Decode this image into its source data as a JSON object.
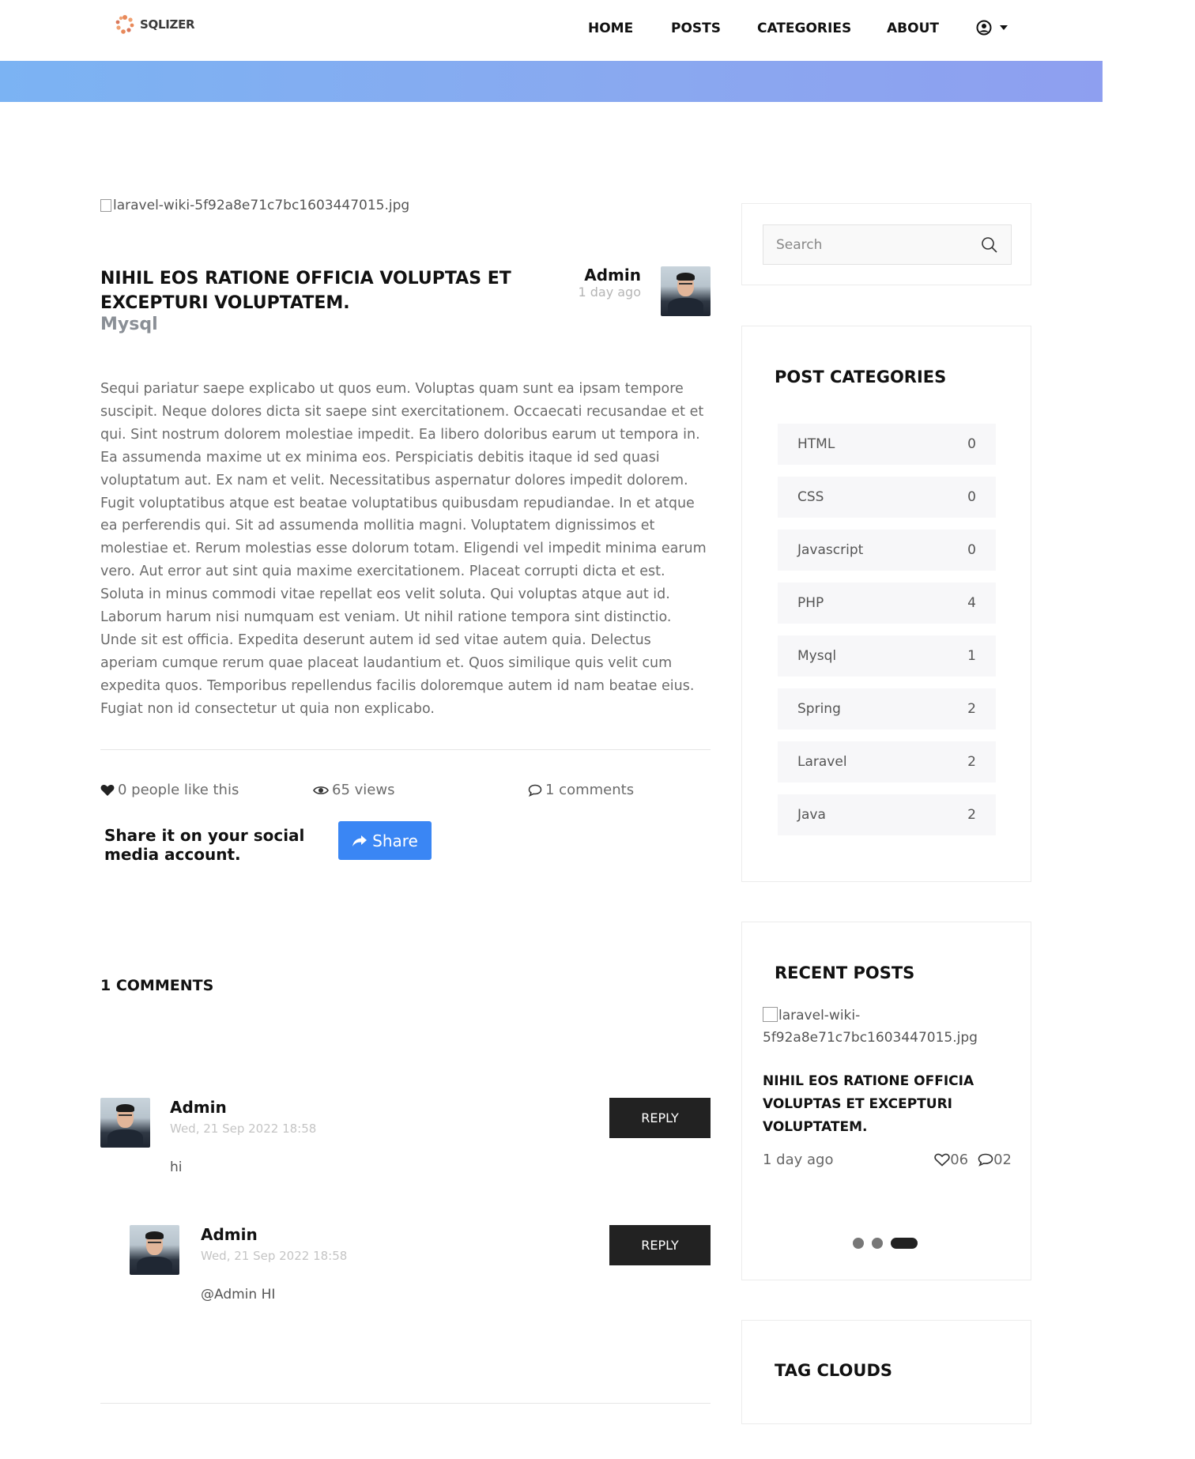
{
  "header": {
    "logo_text": "SQLIZER",
    "nav": [
      "HOME",
      "POSTS",
      "CATEGORIES",
      "ABOUT"
    ]
  },
  "post": {
    "image_alt": "laravel-wiki-5f92a8e71c7bc1603447015.jpg",
    "title": "NIHIL EOS RATIONE OFFICIA VOLUPTAS ET EXCEPTURI VOLUPTATEM.",
    "category": "Mysql",
    "author": "Admin",
    "time": "1 day ago",
    "body": "Sequi pariatur saepe explicabo ut quos eum. Voluptas quam sunt ea ipsam tempore suscipit. Neque dolores dicta sit saepe sint exercitationem. Occaecati recusandae et et qui. Sint nostrum dolorem molestiae impedit. Ea libero doloribus earum ut tempora in. Ea assumenda maxime ut ex minima eos. Perspiciatis debitis itaque id sed quasi voluptatum aut. Ex nam et velit. Necessitatibus aspernatur dolores impedit dolorem. Fugit voluptatibus atque est beatae voluptatibus quibusdam repudiandae. In et atque ea perferendis qui. Sit ad assumenda mollitia magni. Voluptatem dignissimos et molestiae et. Rerum molestias esse dolorum totam. Eligendi vel impedit minima earum vero. Aut error aut sint quia maxime exercitationem. Placeat corrupti dicta et est. Soluta in minus commodi vitae repellat eos velit soluta. Qui voluptas atque aut id. Laborum harum nisi numquam est veniam. Ut nihil ratione tempora sint distinctio. Unde sit est officia. Expedita deserunt autem id sed vitae autem quia. Delectus aperiam cumque rerum quae placeat laudantium et. Quos similique quis velit cum expedita quos. Temporibus repellendus facilis doloremque autem id nam beatae eius. Fugiat non id consectetur ut quia non explicabo.",
    "likes": "0 people like this",
    "views": "65 views",
    "comments": "1 comments",
    "share_text": "Share it on your social media account.",
    "share_label": "Share"
  },
  "comments": {
    "title": "1 COMMENTS",
    "items": [
      {
        "name": "Admin",
        "date": "Wed, 21 Sep 2022 18:58",
        "text": "hi",
        "reply": "REPLY"
      },
      {
        "name": "Admin",
        "date": "Wed, 21 Sep 2022 18:58",
        "text": "@Admin HI",
        "reply": "REPLY"
      }
    ]
  },
  "sidebar": {
    "search_placeholder": "Search",
    "categories_title": "POST CATEGORIES",
    "categories": [
      {
        "name": "HTML",
        "count": "0"
      },
      {
        "name": "CSS",
        "count": "0"
      },
      {
        "name": "Javascript",
        "count": "0"
      },
      {
        "name": "PHP",
        "count": "4"
      },
      {
        "name": "Mysql",
        "count": "1"
      },
      {
        "name": "Spring",
        "count": "2"
      },
      {
        "name": "Laravel",
        "count": "2"
      },
      {
        "name": "Java",
        "count": "2"
      }
    ],
    "recent_title": "RECENT POSTS",
    "recent": {
      "image_alt": "laravel-wiki-5f92a8e71c7bc1603447015.jpg",
      "title": "NIHIL EOS RATIONE OFFICIA VOLUPTAS ET EXCEPTURI VOLUPTATEM.",
      "time": "1 day ago",
      "likes": "06",
      "comments": "02"
    },
    "tags_title": "TAG CLOUDS"
  },
  "colors": {
    "banner_start": "#7bb3f3",
    "banner_end": "#8e9ff0",
    "share_button": "#3a86f4",
    "reply_button": "#222222"
  }
}
